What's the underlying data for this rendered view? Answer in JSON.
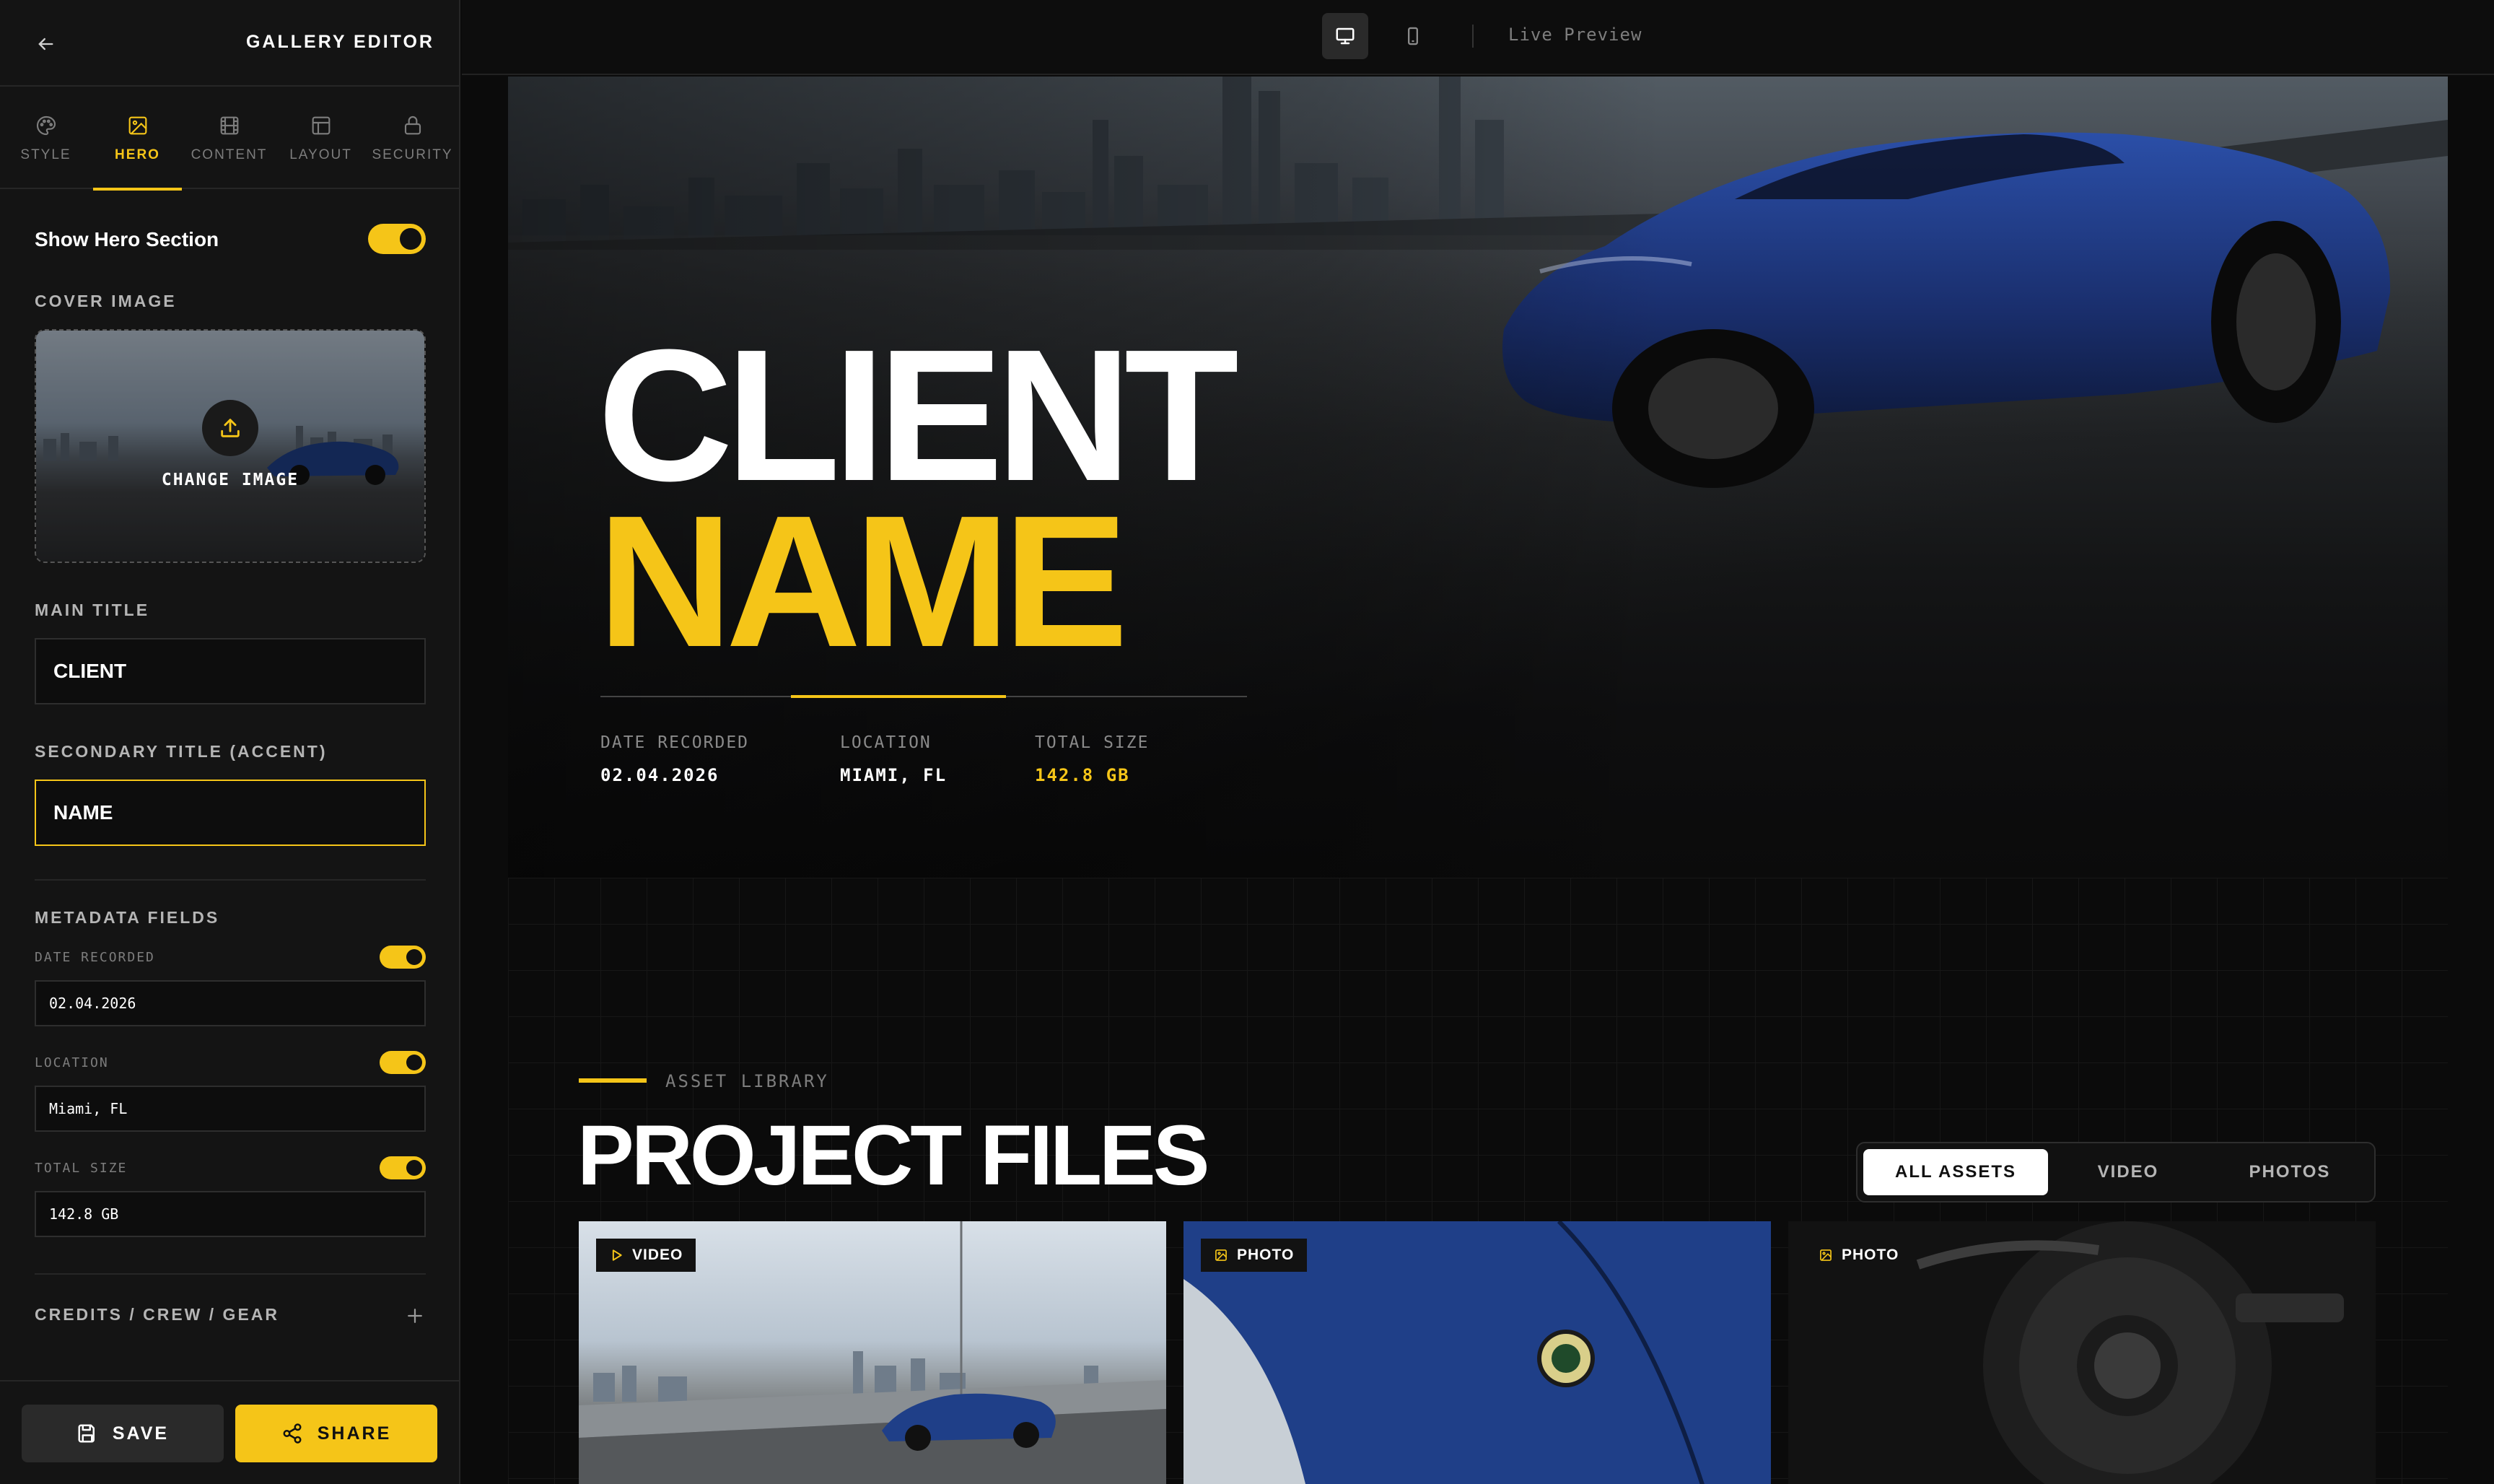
{
  "sidebar": {
    "title": "GALLERY EDITOR",
    "tabs": [
      {
        "label": "STYLE",
        "icon": "palette-icon",
        "active": false
      },
      {
        "label": "HERO",
        "icon": "image-icon",
        "active": true
      },
      {
        "label": "CONTENT",
        "icon": "film-icon",
        "active": false
      },
      {
        "label": "LAYOUT",
        "icon": "layout-icon",
        "active": false
      },
      {
        "label": "SECURITY",
        "icon": "lock-icon",
        "active": false
      }
    ],
    "show_hero_label": "Show Hero Section",
    "cover_image_label": "COVER IMAGE",
    "change_image_label": "CHANGE IMAGE",
    "main_title_label": "MAIN TITLE",
    "main_title_value": "CLIENT",
    "secondary_title_label": "SECONDARY TITLE (ACCENT)",
    "secondary_title_value": "NAME",
    "metadata_label": "METADATA FIELDS",
    "metadata_fields": [
      {
        "label": "DATE RECORDED",
        "value": "02.04.2026",
        "enabled": true
      },
      {
        "label": "LOCATION",
        "value": "Miami, FL",
        "enabled": true
      },
      {
        "label": "TOTAL SIZE",
        "value": "142.8 GB",
        "enabled": true
      }
    ],
    "credits_label": "CREDITS / CREW / GEAR",
    "save_label": "SAVE",
    "share_label": "SHARE"
  },
  "topbar": {
    "live_preview_label": "Live Preview"
  },
  "hero": {
    "title_line1": "CLIENT",
    "title_line2": "NAME",
    "meta": [
      {
        "label": "DATE RECORDED",
        "value": "02.04.2026"
      },
      {
        "label": "LOCATION",
        "value": "MIAMI, FL"
      },
      {
        "label": "TOTAL SIZE",
        "value": "142.8 GB"
      }
    ]
  },
  "library": {
    "eyebrow": "ASSET LIBRARY",
    "title": "PROJECT FILES",
    "filters": [
      "ALL ASSETS",
      "VIDEO",
      "PHOTOS"
    ],
    "active_filter": "ALL ASSETS",
    "cards": [
      {
        "type": "VIDEO"
      },
      {
        "type": "PHOTO"
      },
      {
        "type": "PHOTO"
      }
    ]
  },
  "colors": {
    "accent": "#f5c518",
    "panel": "#141414",
    "background": "#0b0b0b"
  }
}
